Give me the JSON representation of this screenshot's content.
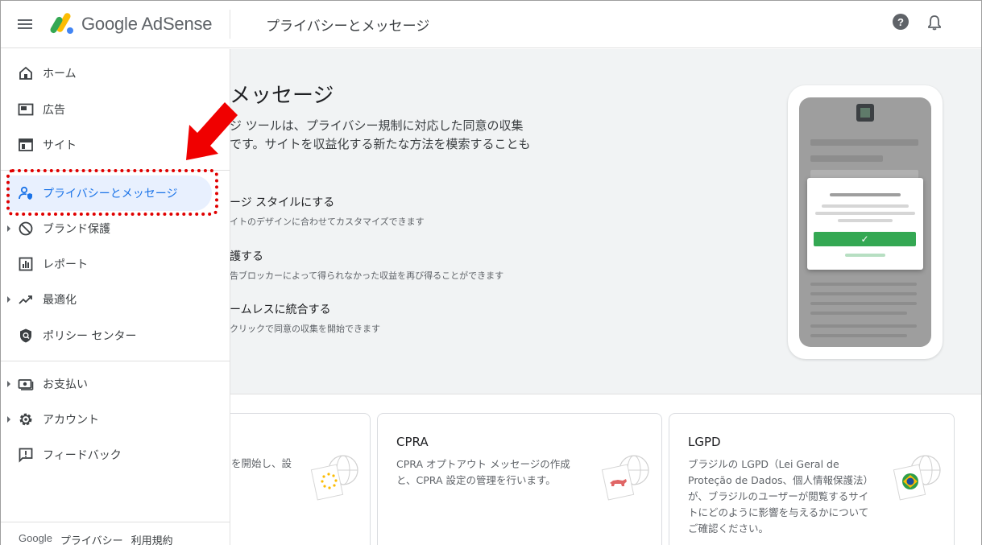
{
  "header": {
    "logo_text": "Google AdSense",
    "page_title": "プライバシーとメッセージ"
  },
  "sidebar": {
    "items": [
      {
        "label": "ホーム",
        "icon": "home-icon"
      },
      {
        "label": "広告",
        "icon": "ads-icon"
      },
      {
        "label": "サイト",
        "icon": "sites-icon"
      },
      {
        "label": "プライバシーとメッセージ",
        "icon": "privacy-icon",
        "active": true
      },
      {
        "label": "ブランド保護",
        "icon": "block-icon",
        "expandable": true
      },
      {
        "label": "レポート",
        "icon": "bar-chart-icon"
      },
      {
        "label": "最適化",
        "icon": "trending-up-icon",
        "expandable": true
      },
      {
        "label": "ポリシー センター",
        "icon": "shield-icon"
      },
      {
        "label": "お支払い",
        "icon": "payments-icon",
        "expandable": true
      },
      {
        "label": "アカウント",
        "icon": "gear-icon",
        "expandable": true
      },
      {
        "label": "フィードバック",
        "icon": "feedback-icon"
      }
    ],
    "footer": {
      "google": "Google",
      "privacy": "プライバシー",
      "terms": "利用規約"
    }
  },
  "hero": {
    "title": "メッセージ",
    "desc_line1": "ジ ツールは、プライバシー規制に対応した同意の収集",
    "desc_line2": "です。サイトを収益化する新たな方法を模索することも",
    "features": [
      {
        "title": "ージ スタイルにする",
        "sub": "イトのデザインに合わせてカスタマイズできます"
      },
      {
        "title": "護する",
        "sub": "告ブロッカーによって得られなかった収益を再び得ることができます"
      },
      {
        "title": "ームレスに統合する",
        "sub": "クリックで同意の収集を開始できます"
      }
    ]
  },
  "cards": [
    {
      "title": "",
      "desc": "を開始し、設"
    },
    {
      "title": "CPRA",
      "desc_line1": "CPRA オプトアウト メッセージの作成",
      "desc_line2": "と、CPRA 設定の管理を行います。"
    },
    {
      "title": "LGPD",
      "desc_line1": "ブラジルの LGPD（Lei Geral de",
      "desc_line2": "Proteção de Dados、個人情報保護法）",
      "desc_line3": "が、ブラジルのユーザーが閲覧するサイ",
      "desc_line4": "トにどのように影響を与えるかについて",
      "desc_line5": "ご確認ください。"
    }
  ],
  "colors": {
    "accent": "#1a73e8",
    "active_bg": "#e8f0fe",
    "annotation_red": "#e00000",
    "confirm_green": "#34a853"
  }
}
